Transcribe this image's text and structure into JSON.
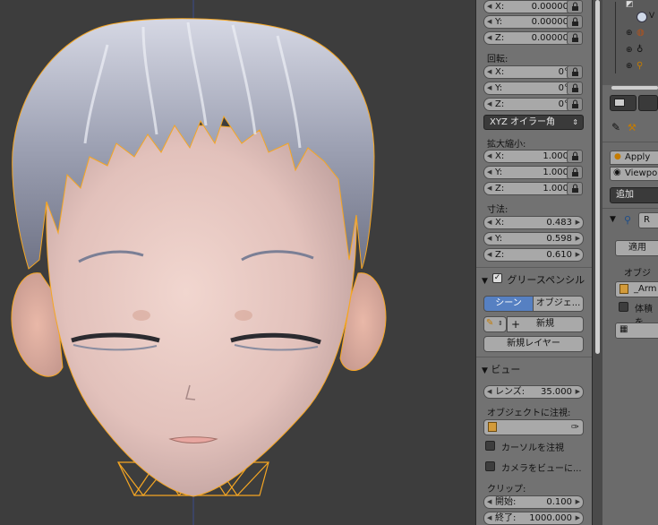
{
  "viewport": {
    "wire_color": "#f5a623"
  },
  "transform": {
    "location": [
      {
        "label": "X:",
        "value": "0.00000"
      },
      {
        "label": "Y:",
        "value": "0.00000"
      },
      {
        "label": "Z:",
        "value": "0.00000"
      }
    ],
    "rotation_label": "回転:",
    "rotation": [
      {
        "label": "X:",
        "value": "0°"
      },
      {
        "label": "Y:",
        "value": "0°"
      },
      {
        "label": "Z:",
        "value": "0°"
      }
    ],
    "rotation_mode": "XYZ オイラー角",
    "scale_label": "拡大縮小:",
    "scale": [
      {
        "label": "X:",
        "value": "1.000"
      },
      {
        "label": "Y:",
        "value": "1.000"
      },
      {
        "label": "Z:",
        "value": "1.000"
      }
    ],
    "dimensions_label": "寸法:",
    "dimensions": [
      {
        "label": "X:",
        "value": "0.483"
      },
      {
        "label": "Y:",
        "value": "0.598"
      },
      {
        "label": "Z:",
        "value": "0.610"
      }
    ]
  },
  "grease_pencil": {
    "title": "グリースペンシル",
    "tab_scene": "シーン",
    "tab_object": "オブジェ...",
    "new": "新規",
    "new_layer": "新規レイヤー"
  },
  "view": {
    "title": "ビュー",
    "lens_label": "レンズ:",
    "lens_value": "35.000",
    "lock_object_label": "オブジェクトに注視:",
    "lock_cursor": "カーソルを注視",
    "lock_camera": "カメラをビューに...",
    "clip_label": "クリップ:",
    "clip_start_label": "開始:",
    "clip_start": "0.100",
    "clip_end_label": "終了:",
    "clip_end": "1000.000"
  },
  "right_panel": {
    "apply": "Apply",
    "viewport": "Viewpo",
    "add": "追加",
    "mod_name": "R",
    "apply_btn": "適用",
    "object_label": "オブジェ",
    "armature": "_Arm",
    "volume": "体積を"
  }
}
